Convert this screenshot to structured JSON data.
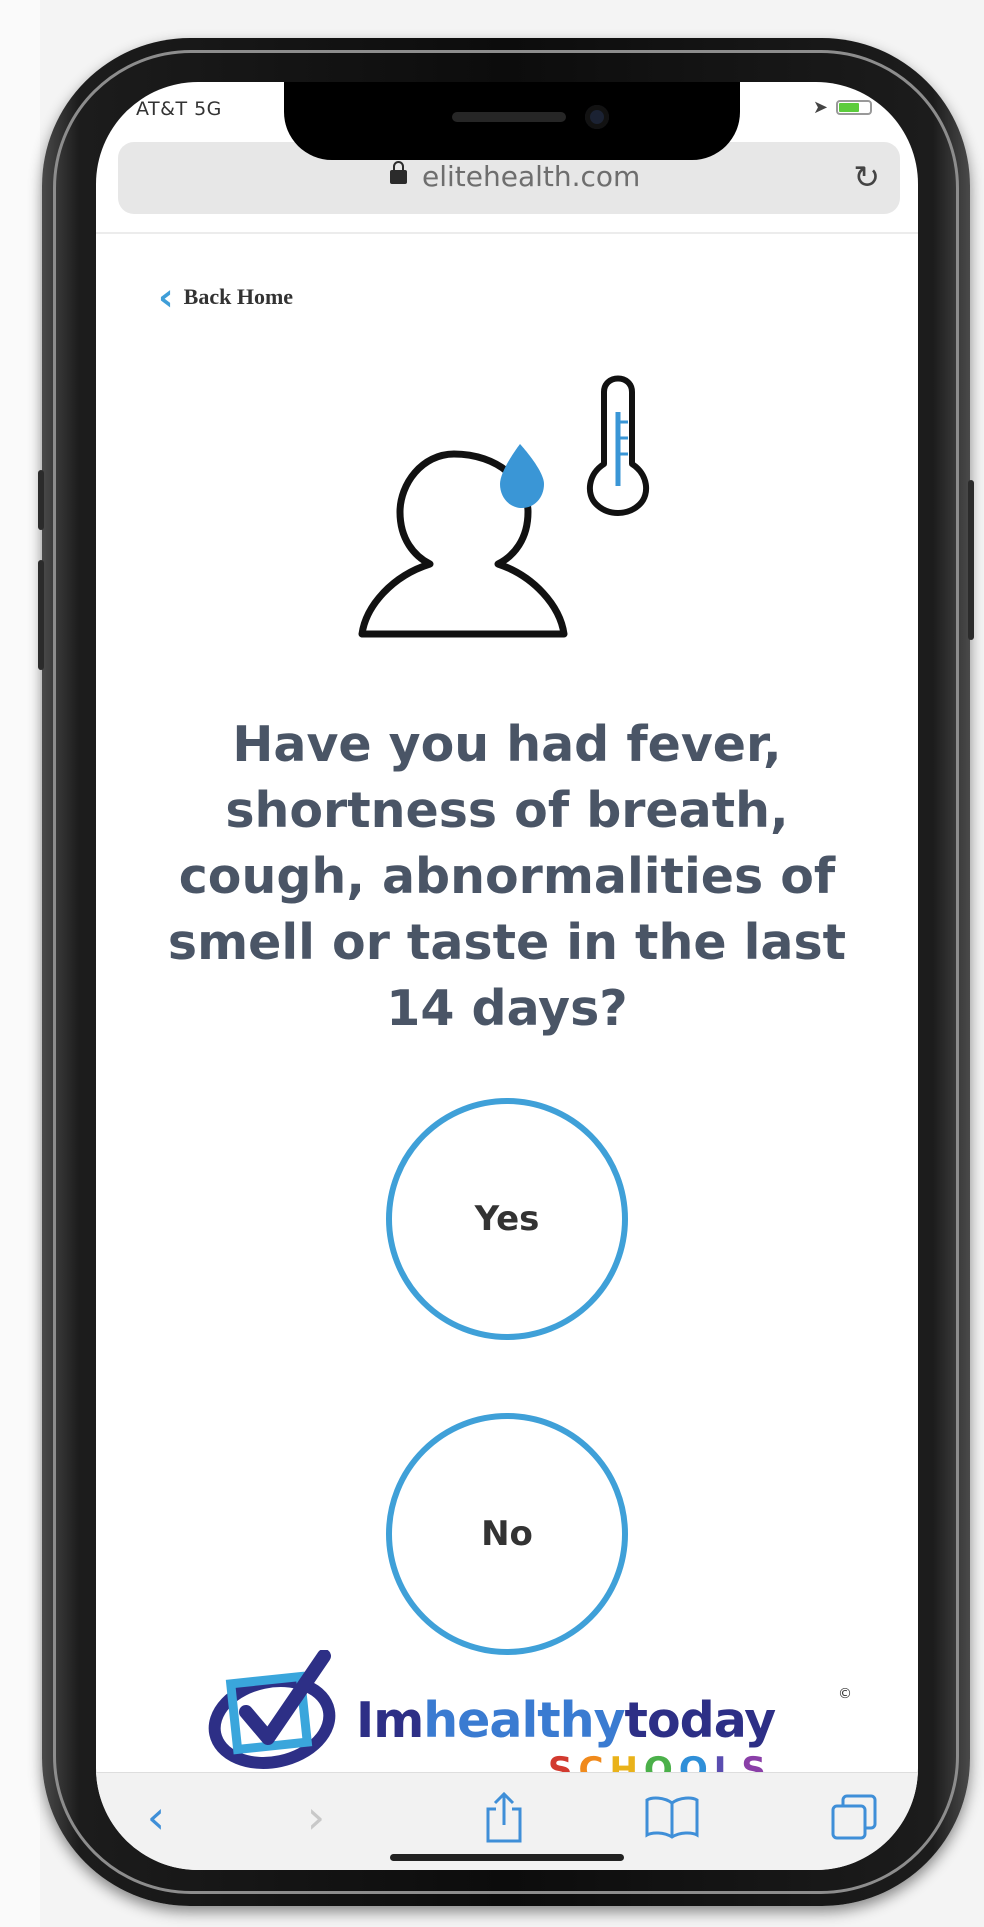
{
  "status_bar": {
    "carrier": "AT&T  5G"
  },
  "browser": {
    "url": "elitehealth.com"
  },
  "page": {
    "back_link": "Back Home",
    "question": "Have you had fever, shortness of breath, cough, abnormalities of smell or taste in the last 14 days?",
    "answers": {
      "yes": "Yes",
      "no": "No"
    }
  },
  "branding": {
    "name_part1": "Im",
    "name_part2": "healthy",
    "name_part3": "today",
    "registered_mark": "©",
    "schools_letters": [
      "S",
      "C",
      "H",
      "O",
      "O",
      "L",
      "S"
    ],
    "schools_colors": [
      "#d23a2f",
      "#f08a1c",
      "#e9b21a",
      "#4bb04a",
      "#2f8fd8",
      "#5a4db0",
      "#8a3fa8"
    ],
    "name_color": "#2d2f86",
    "name_accent_color": "#3a7bd1"
  },
  "colors": {
    "accent": "#3fa0d8",
    "question_text": "#4a5566"
  },
  "icons": {
    "page": [
      "back-chevron-icon",
      "person-with-fever-icon",
      "water-drop-icon",
      "thermometer-icon"
    ],
    "toolbar": [
      "back-arrow-icon",
      "forward-arrow-icon",
      "share-icon",
      "bookmarks-icon",
      "tabs-icon"
    ]
  }
}
